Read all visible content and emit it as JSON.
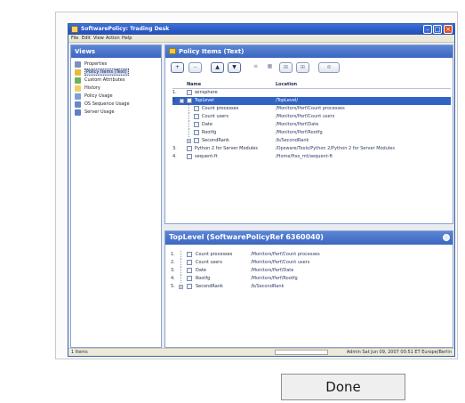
{
  "window": {
    "title": "SoftwarePolicy: Trading Desk",
    "menu": [
      "File",
      "Edit",
      "View",
      "Action",
      "Help"
    ]
  },
  "views": {
    "header": "Views",
    "items": [
      {
        "label": "Properties",
        "icon": "properties-icon",
        "color": "#7a8fc2"
      },
      {
        "label": "Policy Items (Text)",
        "icon": "policy-items-icon",
        "color": "#e8b93a",
        "selected": true
      },
      {
        "label": "Custom Attributes",
        "icon": "attributes-icon",
        "color": "#6bb35b"
      },
      {
        "label": "History",
        "icon": "history-icon",
        "color": "#f0d060"
      },
      {
        "label": "Policy Usage",
        "icon": "policy-usage-icon",
        "color": "#7aa0d8"
      },
      {
        "label": "OS Sequence Usage",
        "icon": "os-sequence-icon",
        "color": "#6a86c4"
      },
      {
        "label": "Server Usage",
        "icon": "server-usage-icon",
        "color": "#5d7fc7"
      }
    ]
  },
  "policy": {
    "header": "Policy Items (Text)",
    "toolbar": [
      "+",
      "−",
      "▲",
      "▼",
      "≡",
      "▦",
      "⊞",
      "⊞",
      "⊜"
    ],
    "columns": [
      "Name",
      "Location"
    ],
    "rows": [
      {
        "num": "1.",
        "name": "winsphere",
        "location": "",
        "level": 0,
        "expander": ""
      },
      {
        "num": "2.",
        "name": "TopLevel",
        "location": "/TopLevel/",
        "level": 0,
        "expander": "−",
        "selected": true
      },
      {
        "num": "",
        "name": "Count processes",
        "location": "/Monitors/Perf/Count processes",
        "level": 1,
        "expander": ""
      },
      {
        "num": "",
        "name": "Count users",
        "location": "/Monitors/Perf/Count users",
        "level": 1,
        "expander": ""
      },
      {
        "num": "",
        "name": "Date",
        "location": "/Monitors/Perf/Date",
        "level": 1,
        "expander": ""
      },
      {
        "num": "",
        "name": "Rootfg",
        "location": "/Monitors/Perf/Rootfg",
        "level": 1,
        "expander": ""
      },
      {
        "num": "",
        "name": "SecondRank",
        "location": "/b/SecondRank",
        "level": 1,
        "expander": "+"
      },
      {
        "num": "3.",
        "name": "Python 2 for Server Modules",
        "location": "/Opsware/Tools/Python 2/Python 2 for Server Modules",
        "level": 0,
        "expander": ""
      },
      {
        "num": "4.",
        "name": "sequent-ft",
        "location": "/Home/ftso_mt/sequent-ft",
        "level": 0,
        "expander": ""
      }
    ]
  },
  "toplevel": {
    "header": "TopLevel (SoftwarePolicyRef 6360040)",
    "rows": [
      {
        "num": "1.",
        "name": "Count processes",
        "location": "/Monitors/Perf/Count processes",
        "expander": ""
      },
      {
        "num": "2.",
        "name": "Count users",
        "location": "/Monitors/Perf/Count users",
        "expander": ""
      },
      {
        "num": "3.",
        "name": "Date",
        "location": "/Monitors/Perf/Date",
        "expander": ""
      },
      {
        "num": "4.",
        "name": "Rootfg",
        "location": "/Monitors/Perf/Rootfg",
        "expander": ""
      },
      {
        "num": "5.",
        "name": "SecondRank",
        "location": "/b/SecondRank",
        "expander": "+"
      }
    ]
  },
  "status": {
    "left": "1 Items",
    "right": "Admin  Sat Jun 09, 2007 00:51 ET Europe/Berlin"
  },
  "done_label": "Done"
}
